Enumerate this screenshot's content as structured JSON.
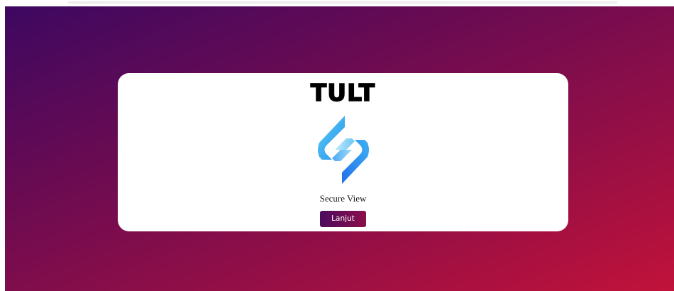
{
  "brand": {
    "wordmark": "TULT",
    "logo_icon": "secure-view-logo-icon"
  },
  "card": {
    "product_name": "Secure View",
    "continue_label": "Lanjut"
  },
  "colors": {
    "background_gradient_start": "#3d0861",
    "background_gradient_end": "#c1123a",
    "button_gradient_start": "#4c0b5e",
    "button_gradient_end": "#8b0f4b",
    "logo_light_blue": "#5ad0f0",
    "logo_deep_blue": "#1f6fe8"
  }
}
